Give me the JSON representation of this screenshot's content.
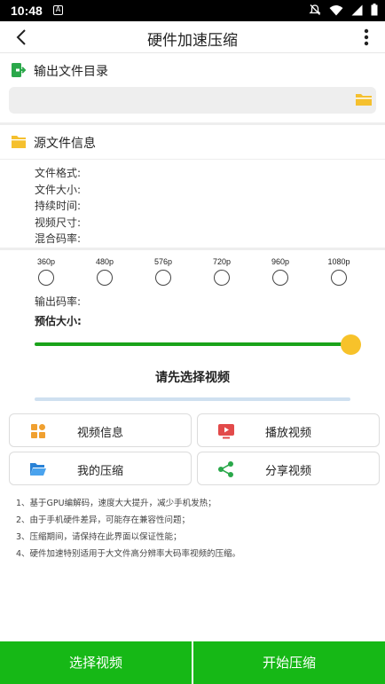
{
  "status_bar": {
    "time": "10:48",
    "notification_icon": "A",
    "icons": [
      "mute-icon",
      "wifi-icon",
      "signal-icon",
      "battery-icon"
    ]
  },
  "app_bar": {
    "title": "硬件加速压缩",
    "back_icon": "chevron-left-icon",
    "menu_icon": "more-vertical-icon"
  },
  "output_dir": {
    "label": "输出文件目录",
    "value": "",
    "icon": "export-icon",
    "folder_icon": "folder-icon"
  },
  "source_info": {
    "label": "源文件信息",
    "icon": "folder-icon",
    "fields": [
      {
        "label": "文件格式:",
        "value": ""
      },
      {
        "label": "文件大小:",
        "value": ""
      },
      {
        "label": "持续时间:",
        "value": ""
      },
      {
        "label": "视频尺寸:",
        "value": ""
      },
      {
        "label": "混合码率:",
        "value": ""
      }
    ]
  },
  "resolutions": [
    "360p",
    "480p",
    "576p",
    "720p",
    "960p",
    "1080p"
  ],
  "bitrate_label": "输出码率:",
  "estimated_size_label": "预估大小:",
  "slider": {
    "value": 1.0
  },
  "select_tip": "请先选择视频",
  "progress": {
    "value": 0
  },
  "actions": [
    {
      "label": "视频信息",
      "icon": "grid-icon",
      "color": "#f0a030"
    },
    {
      "label": "播放视频",
      "icon": "play-screen-icon",
      "color": "#e24a4a"
    },
    {
      "label": "我的压缩",
      "icon": "folder-open-icon",
      "color": "#2a82d6"
    },
    {
      "label": "分享视频",
      "icon": "share-icon",
      "color": "#2aa84a"
    }
  ],
  "notes": [
    "1、基于GPU编解码，速度大大提升，减少手机发热；",
    "2、由于手机硬件差异，可能存在兼容性问题；",
    "3、压缩期间，请保持在此界面以保证性能；",
    "4、硬件加速特别适用于大文件高分辨率大码率视频的压缩。"
  ],
  "bottom": {
    "select_video": "选择视频",
    "start_compress": "开始压缩"
  },
  "colors": {
    "accent_green": "#16b816",
    "slider_thumb": "#f7c22a",
    "folder_yellow": "#f5c02e"
  }
}
